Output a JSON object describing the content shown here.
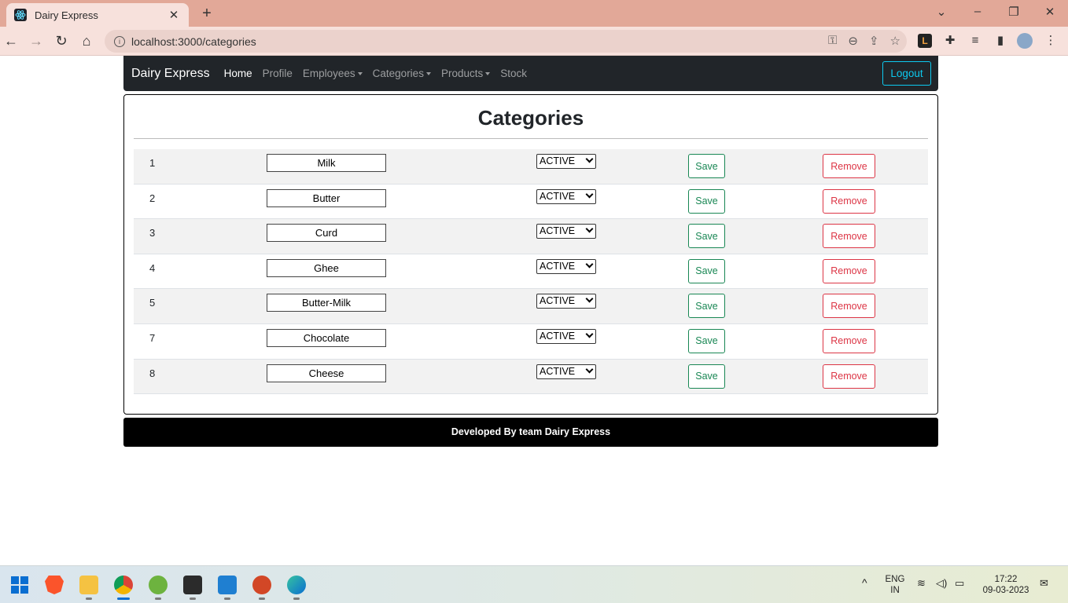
{
  "browser": {
    "tab_title": "Dairy Express",
    "url": "localhost:3000/categories",
    "new_tab": "+",
    "tab_close": "✕"
  },
  "navbar": {
    "brand": "Dairy Express",
    "links": [
      {
        "label": "Home",
        "active": true,
        "dropdown": false
      },
      {
        "label": "Profile",
        "active": false,
        "dropdown": false
      },
      {
        "label": "Employees",
        "active": false,
        "dropdown": true
      },
      {
        "label": "Categories",
        "active": false,
        "dropdown": true
      },
      {
        "label": "Products",
        "active": false,
        "dropdown": true
      },
      {
        "label": "Stock",
        "active": false,
        "dropdown": false
      }
    ],
    "logout": "Logout"
  },
  "page": {
    "title": "Categories"
  },
  "categories": [
    {
      "id": "1",
      "name": "Milk",
      "status": "ACTIVE"
    },
    {
      "id": "2",
      "name": "Butter",
      "status": "ACTIVE"
    },
    {
      "id": "3",
      "name": "Curd",
      "status": "ACTIVE"
    },
    {
      "id": "4",
      "name": "Ghee",
      "status": "ACTIVE"
    },
    {
      "id": "5",
      "name": "Butter-Milk",
      "status": "ACTIVE"
    },
    {
      "id": "7",
      "name": "Chocolate",
      "status": "ACTIVE"
    },
    {
      "id": "8",
      "name": "Cheese",
      "status": "ACTIVE"
    }
  ],
  "row_actions": {
    "save": "Save",
    "remove": "Remove"
  },
  "footer": {
    "text": "Developed By team Dairy Express"
  },
  "taskbar": {
    "lang": "ENG",
    "region": "IN",
    "time": "17:22",
    "date": "09-03-2023"
  },
  "colors": {
    "navbar_bg": "#212529",
    "save": "#198754",
    "remove": "#dc3545",
    "logout": "#0dcaf0",
    "tab_strip": "#e2a898"
  }
}
